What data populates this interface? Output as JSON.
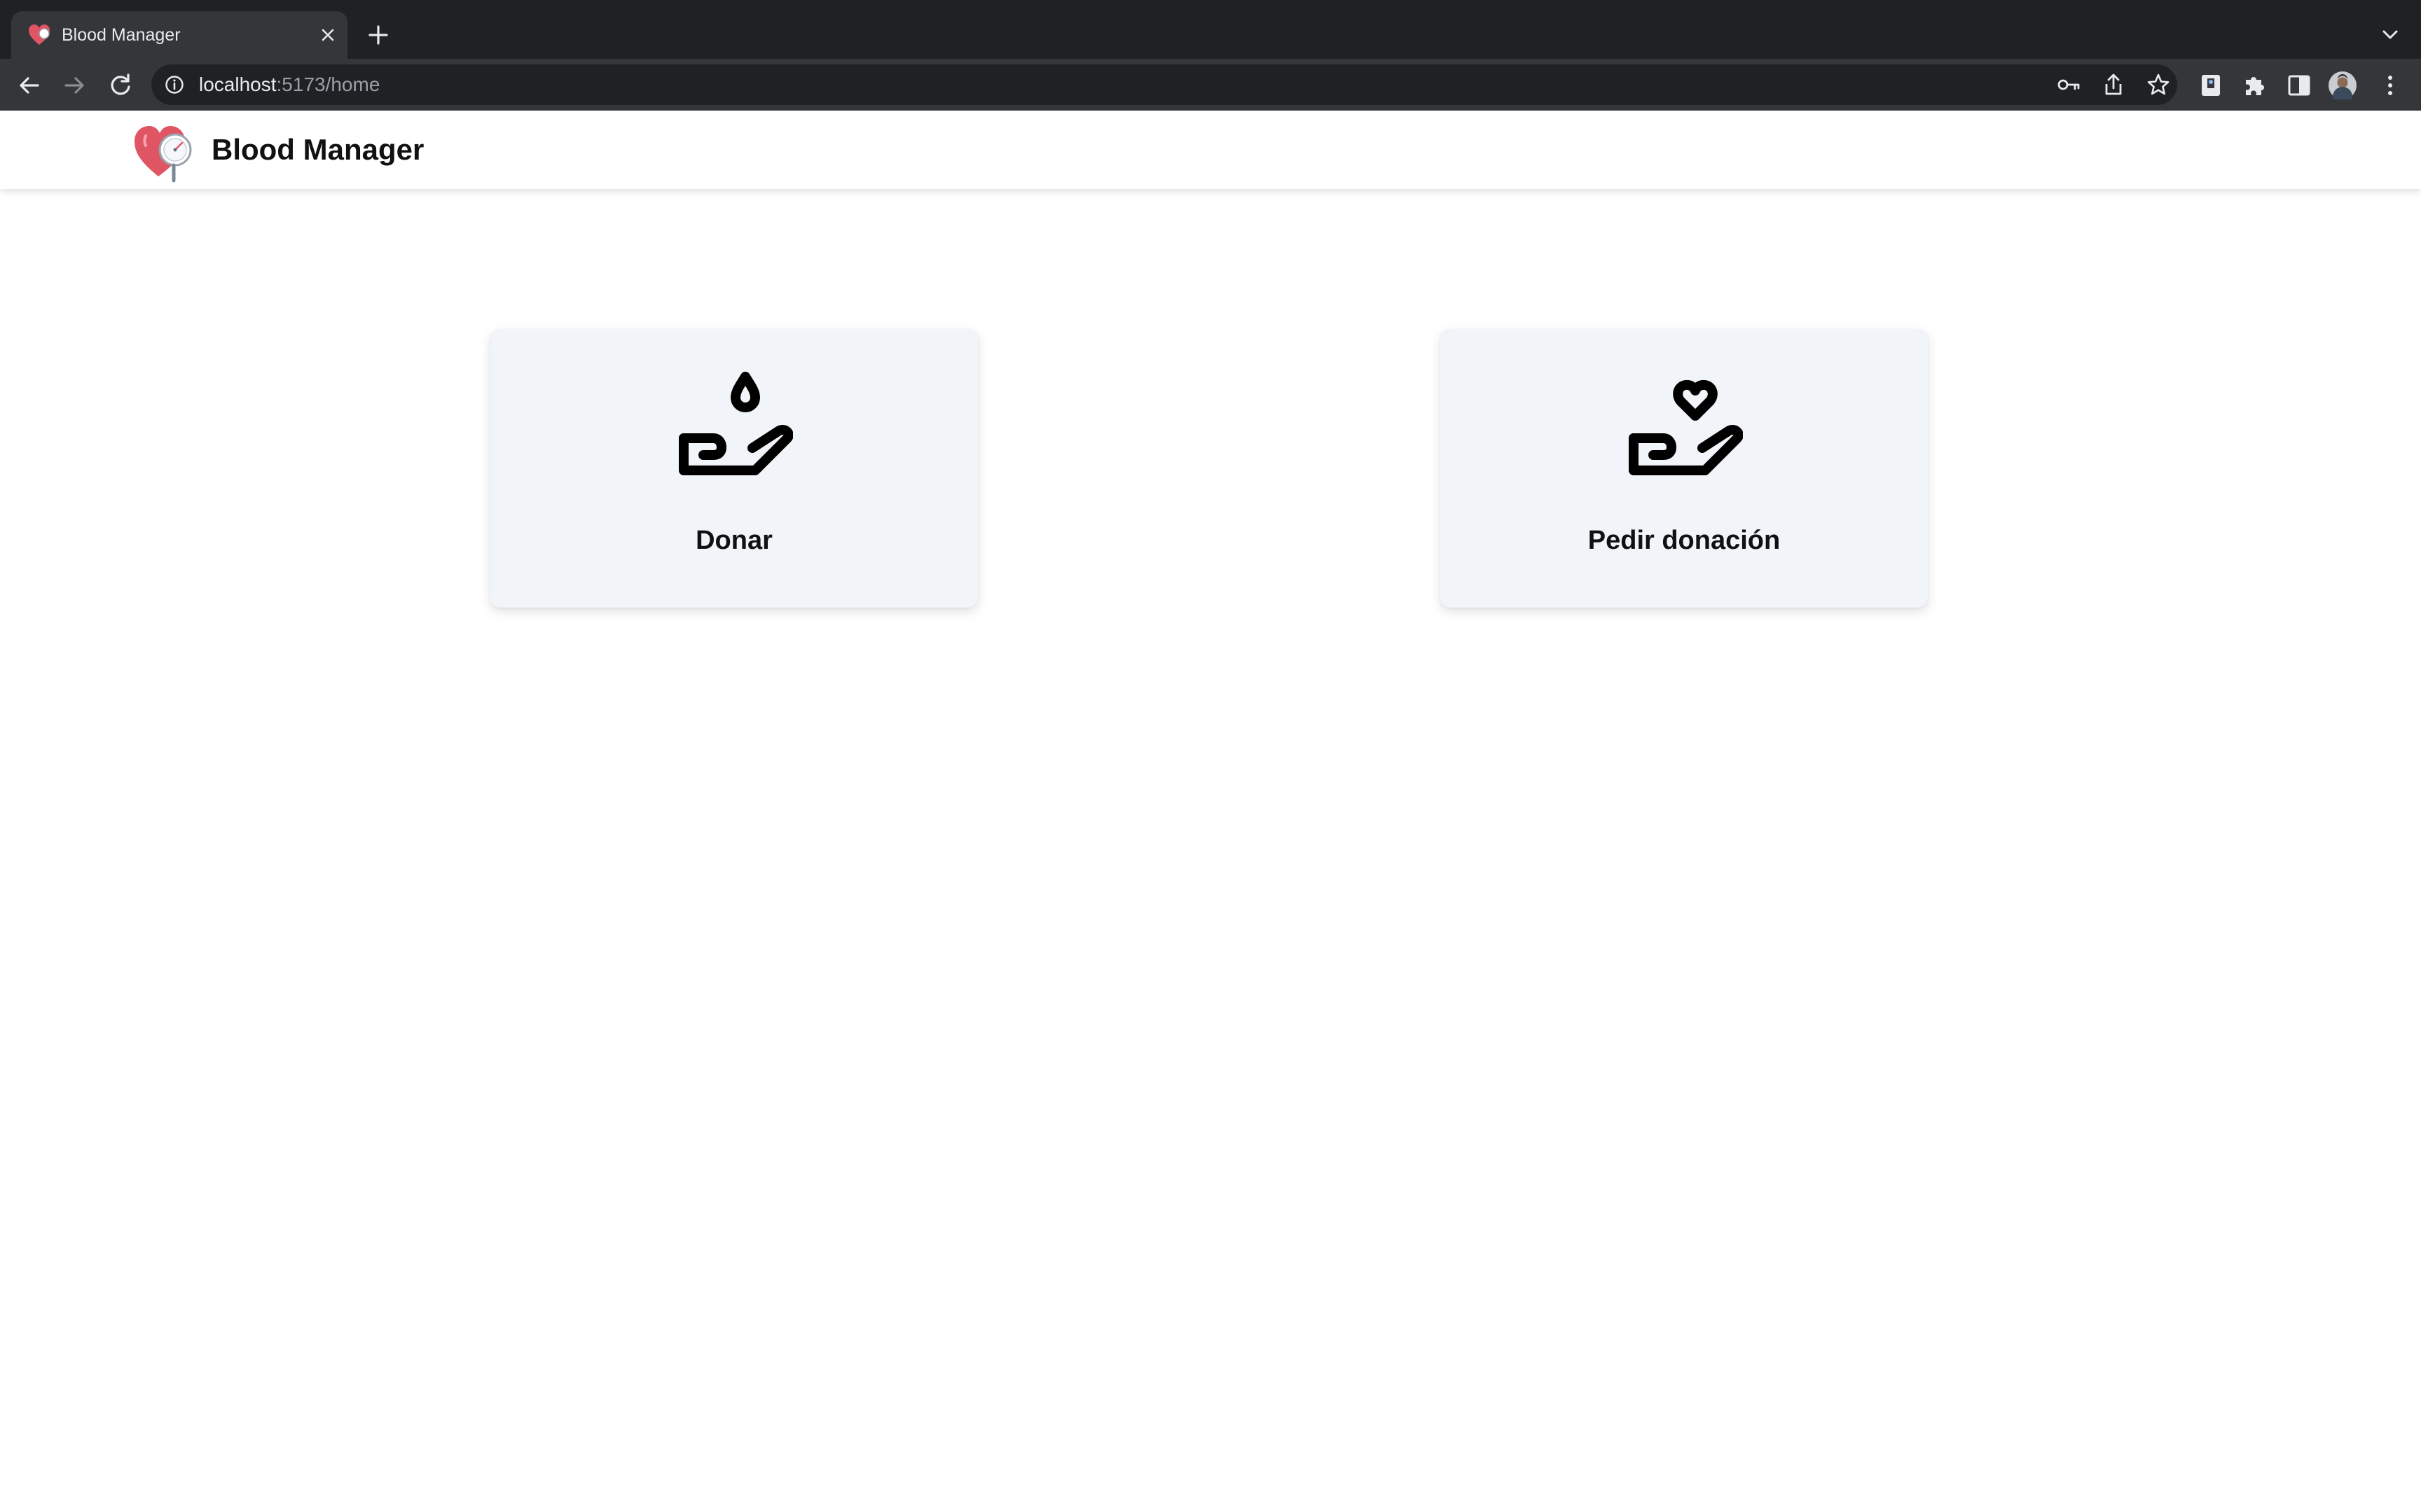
{
  "browser": {
    "tab_title": "Blood Manager",
    "url_host": "localhost",
    "url_path": ":5173/home",
    "icons": {
      "tab_favicon": "heart-icon",
      "tab_close": "close-icon",
      "new_tab": "plus-icon",
      "tab_search": "chevron-down-icon",
      "back": "arrow-left-icon",
      "forward": "arrow-right-icon",
      "reload": "reload-icon",
      "site_info": "info-icon",
      "password": "key-icon",
      "share": "share-icon",
      "bookmark": "star-icon",
      "extension": "extension-box-icon",
      "extensions": "puzzle-icon",
      "side_panel": "side-panel-icon",
      "profile": "avatar",
      "menu": "kebab-menu-icon"
    }
  },
  "app": {
    "brand_name": "Blood Manager",
    "brand_logo": "heart-stethoscope-logo",
    "accent_color": "#e05563",
    "card_background": "#f1f4f9"
  },
  "cards": [
    {
      "label": "Donar",
      "icon": "hand-blood-drop-icon"
    },
    {
      "label": "Pedir donación",
      "icon": "hand-heart-icon"
    }
  ]
}
